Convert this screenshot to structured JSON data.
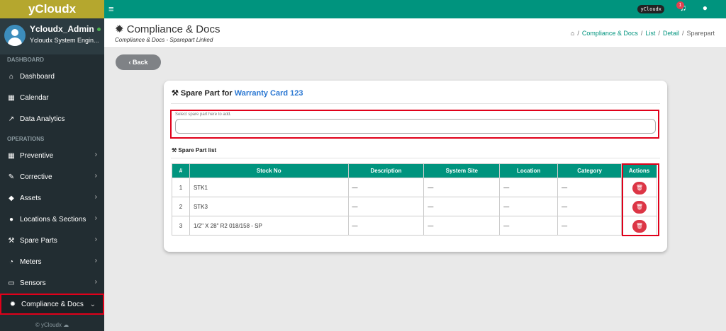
{
  "app": {
    "brand": "yCloudx",
    "footer": "© yCloudx ☁"
  },
  "user": {
    "name": "Ycloudx_Admin",
    "role": "Ycloudx System Engin..."
  },
  "topbar": {
    "logo_badge": "yCloudx",
    "notif_count": "1"
  },
  "nav": {
    "sec_dashboard": "DASHBOARD",
    "sec_operations": "OPERATIONS",
    "dashboard": "Dashboard",
    "calendar": "Calendar",
    "analytics": "Data Analytics",
    "preventive": "Preventive",
    "corrective": "Corrective",
    "assets": "Assets",
    "locations": "Locations & Sections",
    "spare_parts": "Spare Parts",
    "meters": "Meters",
    "sensors": "Sensors",
    "compliance": "Compliance & Docs"
  },
  "page": {
    "title": "Compliance & Docs",
    "subtitle": "Compliance & Docs - Sparepart Linked"
  },
  "breadcrumb": {
    "b1": "Compliance & Docs",
    "b2": "List",
    "b3": "Detail",
    "b4": "Sparepart",
    "sep": "/"
  },
  "back_label": "Back",
  "card": {
    "title_prefix": "Spare Part for ",
    "title_link": "Warranty Card 123",
    "input_label": "Select spare part here to add.",
    "list_title": "Spare Part list"
  },
  "table": {
    "headers": [
      "#",
      "Stock No",
      "Description",
      "System Site",
      "Location",
      "Category",
      "Actions"
    ],
    "rows": [
      {
        "n": "1",
        "stock": "STK1",
        "desc": "—",
        "site": "—",
        "loc": "—",
        "cat": "—"
      },
      {
        "n": "2",
        "stock": "STK3",
        "desc": "—",
        "site": "—",
        "loc": "—",
        "cat": "—"
      },
      {
        "n": "3",
        "stock": "1/2\" X 28\" R2 018/158 - SP",
        "desc": "—",
        "site": "—",
        "loc": "—",
        "cat": "—"
      }
    ]
  },
  "colors": {
    "brand": "#b5a72e",
    "topbar": "#00947e",
    "sidebar": "#222d32",
    "danger": "#dc3545",
    "highlight": "#e0001a"
  }
}
